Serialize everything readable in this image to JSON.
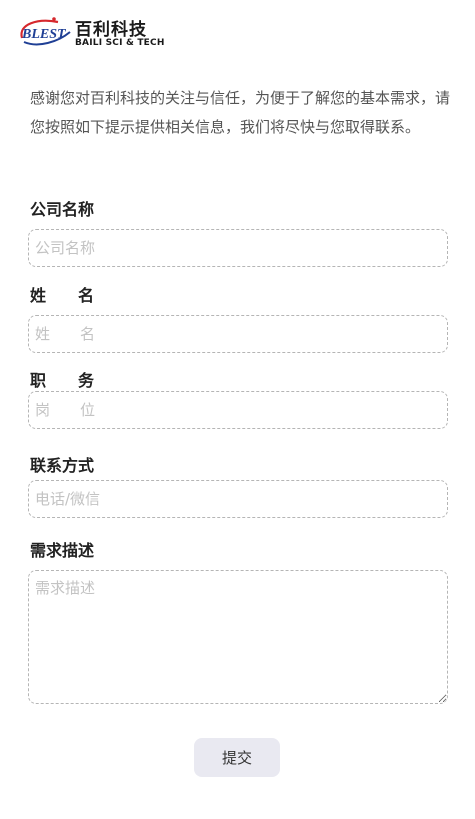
{
  "brand": {
    "logo_mark": "BLEST",
    "name_cn": "百利科技",
    "name_en": "BAILI SCI & TECH",
    "colors": {
      "red": "#d6282d",
      "blue": "#1f3f95",
      "dark": "#1a1a1a"
    }
  },
  "intro": "感谢您对百利科技的关注与信任，为便于了解您的基本需求，请您按照如下提示提供相关信息，我们将尽快与您取得联系。",
  "form": {
    "company": {
      "label": "公司名称",
      "placeholder": "公司名称",
      "value": ""
    },
    "name": {
      "label": "姓　　名",
      "placeholder": "姓　　名",
      "value": ""
    },
    "position": {
      "label": "职　　务",
      "placeholder": "岗　　位",
      "value": ""
    },
    "contact": {
      "label": "联系方式",
      "placeholder": "电话/微信",
      "value": ""
    },
    "demand": {
      "label": "需求描述",
      "placeholder": "需求描述",
      "value": ""
    },
    "submit_label": "提交"
  }
}
